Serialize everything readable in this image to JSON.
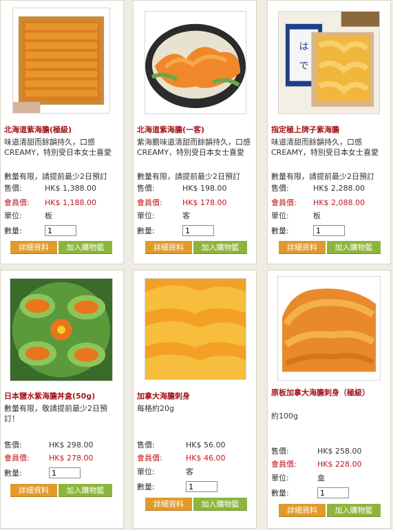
{
  "products": [
    {
      "title": "北海道紫海膽(極級)",
      "desc": "味道清甜而餘韻持久，口感CREAMY，特別受日本女士喜愛",
      "note": "數量有限，請提前最少2日預訂",
      "price_label": "售價:",
      "price": "HK$ 1,388.00",
      "member_label": "會員價:",
      "member_price": "HK$ 1,188.00",
      "unit_label": "單位:",
      "unit": "板",
      "qty_label": "數量:",
      "qty": "1",
      "detail_button": "詳細資料",
      "cart_button": "加入購物籃"
    },
    {
      "title": "北海道紫海膽(一客)",
      "desc": "紫海膽味道清甜而餘韻持久，口感CREAMY，特別受日本女士喜愛",
      "note": "數量有限，請提前最少2日預訂",
      "price_label": "售價:",
      "price": "HK$ 198.00",
      "member_label": "會員價:",
      "member_price": "HK$ 178.00",
      "unit_label": "單位:",
      "unit": "客",
      "qty_label": "數量:",
      "qty": "1",
      "detail_button": "詳細資料",
      "cart_button": "加入購物籃"
    },
    {
      "title": "指定極上牌子紫海膽",
      "desc": "味道清甜而餘韻持久，口感CREAMY，特別受日本女士喜愛",
      "note": "數量有限，請提前最少2日預訂",
      "price_label": "售價:",
      "price": "HK$ 2,288.00",
      "member_label": "會員價:",
      "member_price": "HK$ 2,088.00",
      "unit_label": "單位:",
      "unit": "板",
      "qty_label": "數量:",
      "qty": "1",
      "detail_button": "詳細資料",
      "cart_button": "加入購物籃"
    },
    {
      "title": "日本鹽水紫海膽丼盒(50g)",
      "desc": "數量有限，敬請提前最少2日預訂！",
      "price_label": "售價:",
      "price": "HK$ 298.00",
      "member_label": "會員價:",
      "member_price": "HK$ 278.00",
      "qty_label": "數量:",
      "qty": "1",
      "detail_button": "詳細資料",
      "cart_button": "加入購物籃"
    },
    {
      "title": "加拿大海膽刺身",
      "desc": "每格約20g",
      "price_label": "售價:",
      "price": "HK$ 56.00",
      "member_label": "會員價:",
      "member_price": "HK$ 46.00",
      "unit_label": "單位:",
      "unit": "客",
      "qty_label": "數量:",
      "qty": "1",
      "detail_button": "詳細資料",
      "cart_button": "加入購物籃"
    },
    {
      "title": "原板加拿大海膽刺身（極級）",
      "desc": "約100g",
      "price_label": "售價:",
      "price": "HK$ 258.00",
      "member_label": "會員價:",
      "member_price": "HK$ 228.00",
      "unit_label": "單位:",
      "unit": "盒",
      "qty_label": "數量:",
      "qty": "1",
      "detail_button": "詳細資料",
      "cart_button": "加入購物籃"
    }
  ],
  "colors": {
    "title": "#a2161b",
    "member_price": "#c4161c",
    "detail_button": "#e09a2c",
    "cart_button": "#8db53d",
    "background": "#efece3"
  }
}
